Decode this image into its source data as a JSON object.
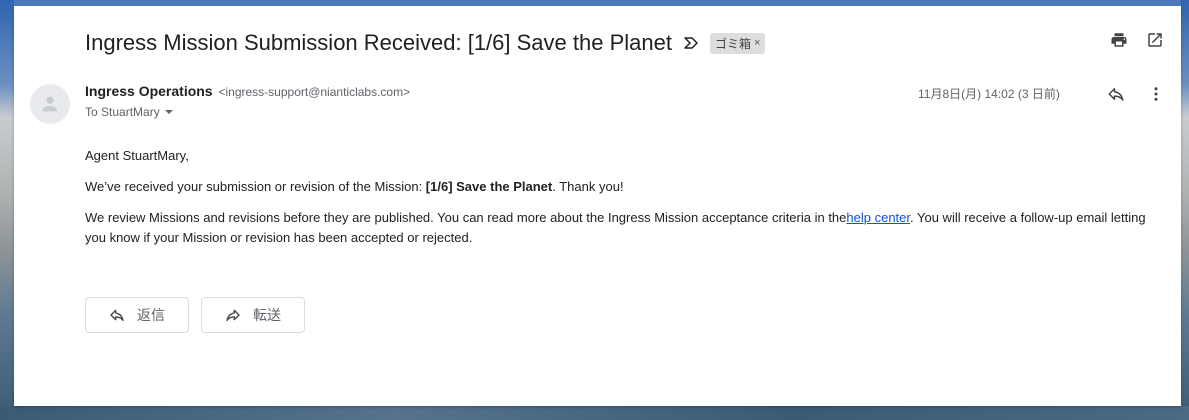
{
  "subject": "Ingress Mission Submission Received: [1/6] Save the Planet",
  "label_chip": "ゴミ箱",
  "label_chip_close": "×",
  "sender": {
    "name": "Ingress Operations",
    "email": "<ingress-support@nianticlabs.com>",
    "to_line": "To StuartMary"
  },
  "date": "11月8日(月) 14:02 (3 日前)",
  "body": {
    "greeting": "Agent StuartMary,",
    "p1_before": "We’ve received your submission or revision of the Mission: ",
    "p1_bold": "[1/6] Save the Planet",
    "p1_after": ". Thank you!",
    "p2_before": "We review Missions and revisions before they are published. You can read more about the Ingress Mission acceptance criteria in the",
    "p2_link": "help center",
    "p2_after": ". You will receive a follow-up email letting you know if your Mission or revision has been accepted or rejected."
  },
  "buttons": {
    "reply": "返信",
    "forward": "転送"
  },
  "icons": {
    "important": "important-marker-icon",
    "print": "print-icon",
    "open_new_window": "open-in-new-window-icon",
    "reply": "reply-icon",
    "more": "more-vert-icon",
    "avatar": "avatar-person-icon",
    "to_dropdown": "chevron-down-icon",
    "forward": "forward-icon"
  },
  "colors": {
    "link": "#1155cc",
    "chip_bg": "#dddddd"
  }
}
